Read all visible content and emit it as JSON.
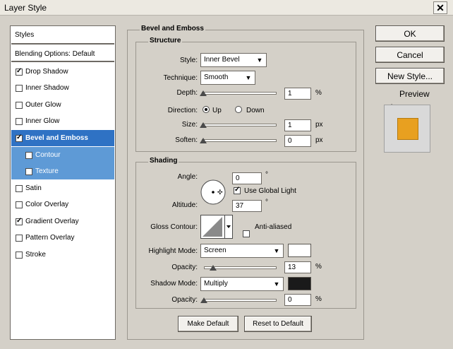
{
  "window": {
    "title": "Layer Style",
    "close_glyph": "✕"
  },
  "sidebar": {
    "header": "Styles",
    "blending": "Blending Options: Default",
    "items": [
      {
        "label": "Drop Shadow",
        "checked": true
      },
      {
        "label": "Inner Shadow",
        "checked": false
      },
      {
        "label": "Outer Glow",
        "checked": false
      },
      {
        "label": "Inner Glow",
        "checked": false
      },
      {
        "label": "Bevel and Emboss",
        "checked": true
      },
      {
        "label": "Contour",
        "checked": false
      },
      {
        "label": "Texture",
        "checked": false
      },
      {
        "label": "Satin",
        "checked": false
      },
      {
        "label": "Color Overlay",
        "checked": false
      },
      {
        "label": "Gradient Overlay",
        "checked": true
      },
      {
        "label": "Pattern Overlay",
        "checked": false
      },
      {
        "label": "Stroke",
        "checked": false
      }
    ]
  },
  "bevel": {
    "title": "Bevel and Emboss",
    "structure": {
      "title": "Structure",
      "style_label": "Style:",
      "style_value": "Inner Bevel",
      "technique_label": "Technique:",
      "technique_value": "Smooth",
      "depth_label": "Depth:",
      "depth_value": "1",
      "depth_unit": "%",
      "direction_label": "Direction:",
      "dir_up": "Up",
      "dir_down": "Down",
      "size_label": "Size:",
      "size_value": "1",
      "size_unit": "px",
      "soften_label": "Soften:",
      "soften_value": "0",
      "soften_unit": "px"
    },
    "shading": {
      "title": "Shading",
      "angle_label": "Angle:",
      "angle_value": "0",
      "degree": "°",
      "global_light": "Use Global Light",
      "altitude_label": "Altitude:",
      "altitude_value": "37",
      "gloss_label": "Gloss Contour:",
      "anti_aliased": "Anti-aliased",
      "highlight_label": "Highlight Mode:",
      "highlight_value": "Screen",
      "highlight_color": "#ffffff",
      "hl_opacity_label": "Opacity:",
      "hl_opacity_value": "13",
      "pct": "%",
      "shadow_label": "Shadow Mode:",
      "shadow_value": "Multiply",
      "shadow_color": "#1a1a1a",
      "sh_opacity_label": "Opacity:",
      "sh_opacity_value": "0"
    },
    "make_default": "Make Default",
    "reset_default": "Reset to Default"
  },
  "buttons": {
    "ok": "OK",
    "cancel": "Cancel",
    "new_style": "New Style...",
    "preview": "Preview"
  },
  "preview_color": "#e8a020"
}
